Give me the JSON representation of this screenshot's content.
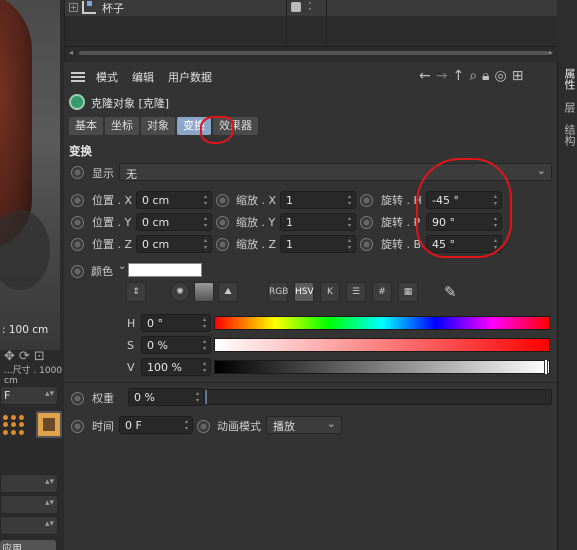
{
  "left_panel": {
    "coord_readout": ": 100 cm",
    "coord_readout_secondary": "...尺寸 . 1000 cm",
    "frame_field": "F",
    "apply_button": "应用"
  },
  "object_manager": {
    "object_name": "杯子"
  },
  "side_tabs": [
    "属性",
    "层",
    "结构"
  ],
  "attribute_manager": {
    "menu": [
      "模式",
      "编辑",
      "用户数据"
    ],
    "nav_icons": [
      "arrow-left-icon",
      "arrow-right-icon",
      "arrow-up-icon",
      "search-icon",
      "lock-icon",
      "target-icon",
      "new-window-icon"
    ],
    "object_title": "克隆对象 [克隆]",
    "tabs": [
      "基本",
      "坐标",
      "对象",
      "变换",
      "效果器"
    ],
    "active_tab": "变换",
    "section_title": "变换",
    "display": {
      "label": "显示",
      "value": "无"
    },
    "position": [
      {
        "label": "位置 . X",
        "value": "0 cm"
      },
      {
        "label": "位置 . Y",
        "value": "0 cm"
      },
      {
        "label": "位置 . Z",
        "value": "0 cm"
      }
    ],
    "scale": [
      {
        "label": "缩放 . X",
        "value": "1"
      },
      {
        "label": "缩放 . Y",
        "value": "1"
      },
      {
        "label": "缩放 . Z",
        "value": "1"
      }
    ],
    "rotation": [
      {
        "label": "旋转 . H",
        "value": "-45 °"
      },
      {
        "label": "旋转 . P",
        "value": "90 °"
      },
      {
        "label": "旋转 . B",
        "value": "45 °"
      }
    ],
    "color": {
      "label": "颜色",
      "swatch_color": "#ffffff",
      "mode_buttons": [
        "RGB",
        "HSV",
        "K"
      ],
      "active_mode": "HSV",
      "h": {
        "label": "H",
        "value": "0 °"
      },
      "s": {
        "label": "S",
        "value": "0 %"
      },
      "v": {
        "label": "V",
        "value": "100 %",
        "level": 1.0
      }
    },
    "weight": {
      "label": "权重",
      "value": "0 %"
    },
    "time": {
      "label": "时间",
      "value": "0 F"
    },
    "anim_mode": {
      "label": "动画模式",
      "value": "播放"
    }
  },
  "colors": {
    "accent_tab": "#8aa7c8",
    "annotation_red": "#e0151a",
    "panel_bg": "#333333"
  }
}
